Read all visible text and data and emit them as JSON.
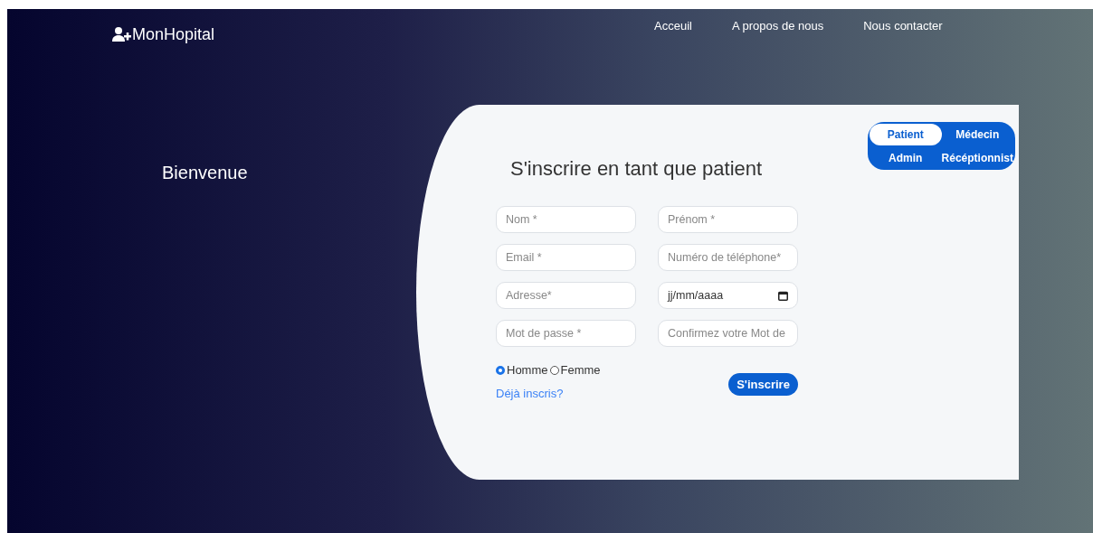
{
  "brand": {
    "name": "MonHopital"
  },
  "nav": [
    {
      "label": "Acceuil"
    },
    {
      "label": "A propos de nous"
    },
    {
      "label": "Nous contacter"
    }
  ],
  "welcome": "Bienvenue",
  "form": {
    "title": "S'inscrire en tant que patient",
    "roles": [
      {
        "label": "Patient",
        "selected": true
      },
      {
        "label": "Médecin",
        "selected": false
      },
      {
        "label": "Admin",
        "selected": false
      },
      {
        "label": "Récéptionnist",
        "selected": false
      }
    ],
    "fields": [
      {
        "kind": "text",
        "placeholder": "Nom *"
      },
      {
        "kind": "text",
        "placeholder": "Prénom *"
      },
      {
        "kind": "text",
        "placeholder": "Email *"
      },
      {
        "kind": "text",
        "placeholder": "Numéro de téléphone*"
      },
      {
        "kind": "text",
        "placeholder": "Adresse*"
      },
      {
        "kind": "date",
        "placeholder": "jj/mm/aaaa"
      },
      {
        "kind": "text",
        "placeholder": "Mot de passe *"
      },
      {
        "kind": "text",
        "placeholder": "Confirmez votre Mot de"
      }
    ],
    "gender": [
      {
        "label": "Homme",
        "selected": true
      },
      {
        "label": "Femme",
        "selected": false
      }
    ],
    "login_link": "Déjà inscris?",
    "submit": "S'inscrire"
  }
}
